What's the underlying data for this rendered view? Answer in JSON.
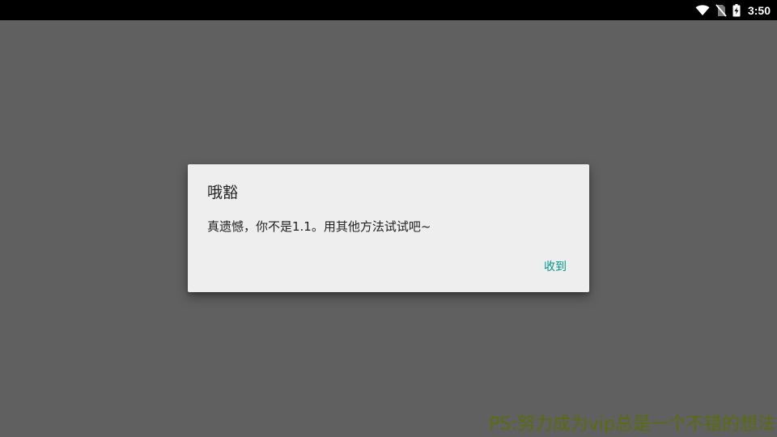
{
  "status_bar": {
    "time": "3:50",
    "icons": [
      "wifi-icon",
      "no-sim-icon",
      "battery-charging-icon"
    ]
  },
  "dialog": {
    "title": "哦豁",
    "message": "真遗憾，你不是1.1。用其他方法试试吧~",
    "button_label": "收到",
    "accent_color": "#009688"
  },
  "watermark": {
    "text": "PS:努力成为vip总是一个不错的想法"
  },
  "colors": {
    "scrim": "#606060",
    "dialog_bg": "#eeeeee",
    "status_bar_bg": "#000000",
    "watermark": "#5a6b10"
  }
}
